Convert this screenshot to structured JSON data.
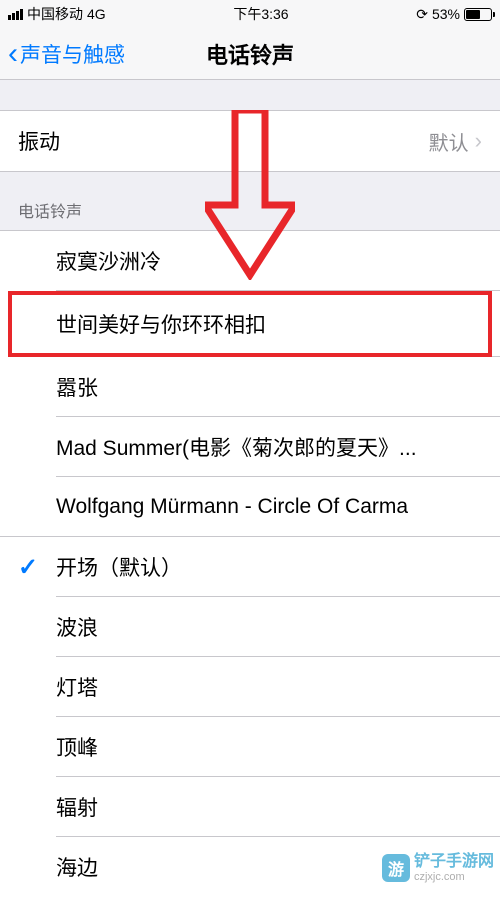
{
  "status": {
    "carrier": "中国移动",
    "network": "4G",
    "time": "下午3:36",
    "battery_pct": "53%"
  },
  "nav": {
    "back_label": "声音与触感",
    "title": "电话铃声"
  },
  "vibration": {
    "label": "振动",
    "value": "默认"
  },
  "section_header": "电话铃声",
  "custom_tones": [
    "寂寞沙洲冷",
    "世间美好与你环环相扣",
    "嚣张",
    "Mad Summer(电影《菊次郎的夏天》...",
    "Wolfgang Mürmann - Circle Of Carma"
  ],
  "system_tones": [
    "开场（默认）",
    "波浪",
    "灯塔",
    "顶峰",
    "辐射",
    "海边"
  ],
  "checked_index": 0,
  "watermark": {
    "title": "铲子手游网",
    "url": "czjxjc.com"
  }
}
